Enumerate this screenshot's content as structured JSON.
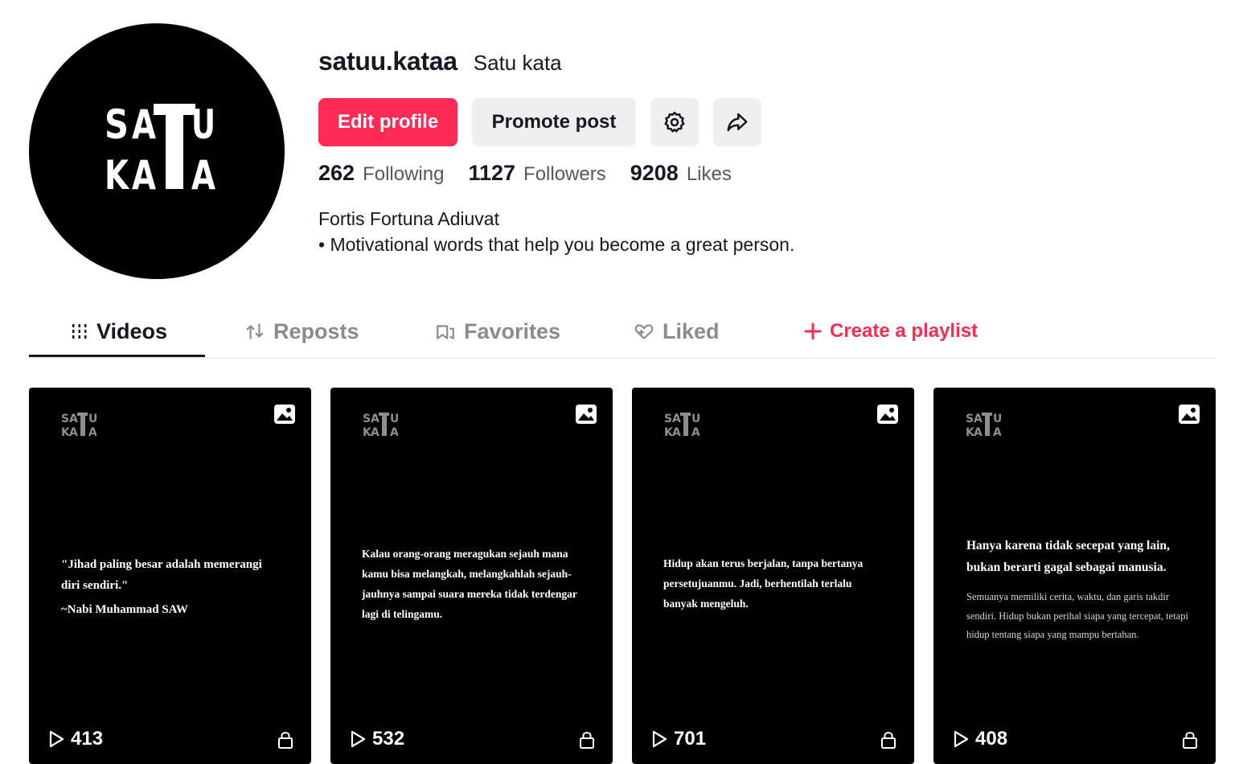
{
  "profile": {
    "username": "satuu.kataa",
    "nickname": "Satu kata",
    "avatar_logo_text": "SATU KATA",
    "bio_line1": "Fortis Fortuna Adiuvat",
    "bio_line2": "• Motivational words that help you become a great person."
  },
  "actions": {
    "edit_profile": "Edit profile",
    "promote_post": "Promote post",
    "settings_icon": "gear-icon",
    "share_icon": "share-arrow-icon"
  },
  "stats": [
    {
      "count": "262",
      "label": "Following"
    },
    {
      "count": "1127",
      "label": "Followers"
    },
    {
      "count": "9208",
      "label": "Likes"
    }
  ],
  "tabs": [
    {
      "label": "Videos",
      "icon": "grid-bars-icon",
      "active": true
    },
    {
      "label": "Reposts",
      "icon": "repost-icon",
      "active": false
    },
    {
      "label": "Favorites",
      "icon": "bookmark-icon",
      "active": false
    },
    {
      "label": "Liked",
      "icon": "heart-icon",
      "active": false
    }
  ],
  "create_playlist": "Create a playlist",
  "videos": [
    {
      "views": "413",
      "quote": "\"Jihad paling besar adalah memerangi diri sendiri.\"",
      "author": "~Nabi Muhammad SAW"
    },
    {
      "views": "532",
      "quote": "Kalau orang-orang meragukan sejauh mana kamu bisa melangkah, melangkahlah sejauh-jauhnya sampai suara mereka tidak terdengar lagi di telingamu."
    },
    {
      "views": "701",
      "quote": "Hidup akan terus berjalan, tanpa bertanya persetujuanmu. Jadi, berhentilah terlalu banyak mengeluh."
    },
    {
      "views": "408",
      "quote_heading": "Hanya karena tidak secepat yang lain, bukan berarti gagal sebagai manusia.",
      "quote_body": "Semuanya memiliki cerita, waktu, dan garis takdir sendiri. Hidup bukan perihal siapa yang tercepat, tetapi hidup tentang siapa yang mampu bertahan."
    }
  ],
  "colors": {
    "accent": "#fe2c55",
    "text": "#161823",
    "muted": "#8a8b91",
    "card_bg": "#000000"
  }
}
